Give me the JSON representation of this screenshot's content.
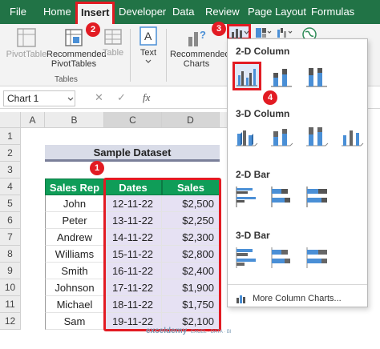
{
  "ribbon_tabs": [
    {
      "label": "File"
    },
    {
      "label": "Home"
    },
    {
      "label": "Insert"
    },
    {
      "label": "Developer"
    },
    {
      "label": "Data"
    },
    {
      "label": "Review"
    },
    {
      "label": "Page Layout"
    },
    {
      "label": "Formulas"
    }
  ],
  "ribbon": {
    "pivottable_label": "PivotTable",
    "recommended_pivottables_label": "Recommended PivotTables",
    "table_label": "Table",
    "tables_group_label": "Tables",
    "text_label": "Text",
    "recommended_charts_label": "Recommended Charts"
  },
  "callouts": [
    "1",
    "2",
    "3",
    "4"
  ],
  "formula_bar": {
    "name_box": "Chart 1",
    "cancel_icon": "✕",
    "confirm_icon": "✓",
    "fx_label": "fx"
  },
  "sheet": {
    "columns": [
      "A",
      "B",
      "C",
      "D"
    ],
    "rows": [
      "1",
      "2",
      "3",
      "4",
      "5",
      "6",
      "7",
      "8",
      "9",
      "10",
      "11",
      "12"
    ],
    "title": "Sample Dataset",
    "headers": [
      "Sales Rep",
      "Dates",
      "Sales"
    ],
    "data": [
      [
        "John",
        "12-11-22",
        "$2,500"
      ],
      [
        "Peter",
        "13-11-22",
        "$2,250"
      ],
      [
        "Andrew",
        "14-11-22",
        "$2,300"
      ],
      [
        "Williams",
        "15-11-22",
        "$2,800"
      ],
      [
        "Smith",
        "16-11-22",
        "$2,400"
      ],
      [
        "Johnson",
        "17-11-22",
        "$1,900"
      ],
      [
        "Michael",
        "18-11-22",
        "$1,750"
      ],
      [
        "Sam",
        "19-11-22",
        "$2,100"
      ]
    ]
  },
  "chart_menu": {
    "sections": [
      "2-D Column",
      "3-D Column",
      "2-D Bar",
      "3-D Bar"
    ],
    "more_label": "More Column Charts..."
  },
  "watermark": {
    "name": "exceldemy",
    "tagline": "EXCEL · DATA · BI"
  },
  "colors": {
    "ribbon_green": "#217346",
    "callout_red": "#e21b23",
    "header_green": "#0f9d58",
    "selection_lilac": "#e6e1f3",
    "title_band": "#d9dce8"
  }
}
